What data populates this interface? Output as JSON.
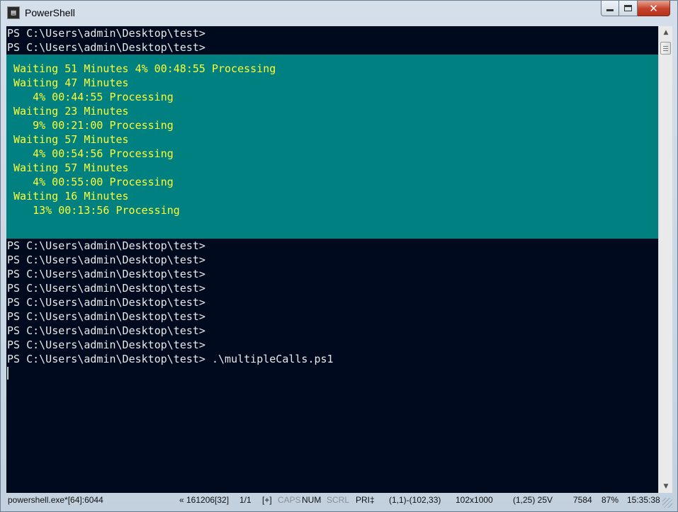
{
  "window": {
    "title": "PowerShell",
    "app_icon": "console-icon"
  },
  "caption_buttons": {
    "minimize": "minimize-icon",
    "maximize": "maximize-icon",
    "close": "✕"
  },
  "console": {
    "lines_top": [
      "PS C:\\Users\\admin\\Desktop\\test>",
      "PS C:\\Users\\admin\\Desktop\\test>"
    ],
    "progress_panel": [
      "Waiting 51 Minutes 4% 00:48:55 Processing",
      "Waiting 47 Minutes",
      "   4% 00:44:55 Processing",
      "Waiting 23 Minutes",
      "   9% 00:21:00 Processing",
      "Waiting 57 Minutes",
      "   4% 00:54:56 Processing",
      "Waiting 57 Minutes",
      "   4% 00:55:00 Processing",
      "Waiting 16 Minutes",
      "   13% 00:13:56 Processing"
    ],
    "lines_bottom": [
      "PS C:\\Users\\admin\\Desktop\\test>",
      "PS C:\\Users\\admin\\Desktop\\test>",
      "PS C:\\Users\\admin\\Desktop\\test>",
      "PS C:\\Users\\admin\\Desktop\\test>",
      "PS C:\\Users\\admin\\Desktop\\test>",
      "PS C:\\Users\\admin\\Desktop\\test>",
      "PS C:\\Users\\admin\\Desktop\\test>",
      "PS C:\\Users\\admin\\Desktop\\test>",
      "PS C:\\Users\\admin\\Desktop\\test> .\\multipleCalls.ps1"
    ],
    "colors": {
      "background": "#000a1e",
      "panel": "#008080",
      "panel_text": "#ffff33",
      "text": "#e8e8e8"
    }
  },
  "statusbar": {
    "process": "powershell.exe*[64]:6044",
    "history": "« 161206[32]",
    "pages": "1/1",
    "plus": "[+]",
    "caps": "CAPS",
    "num": "NUM",
    "scrl": "SCRL",
    "pri": "PRI‡",
    "selection": "(1,1)-(102,33)",
    "buffer": "102x1000",
    "cursor": "(1,25) 25V",
    "pid": "7584",
    "zoom": "87%",
    "time": "15:35:38"
  }
}
